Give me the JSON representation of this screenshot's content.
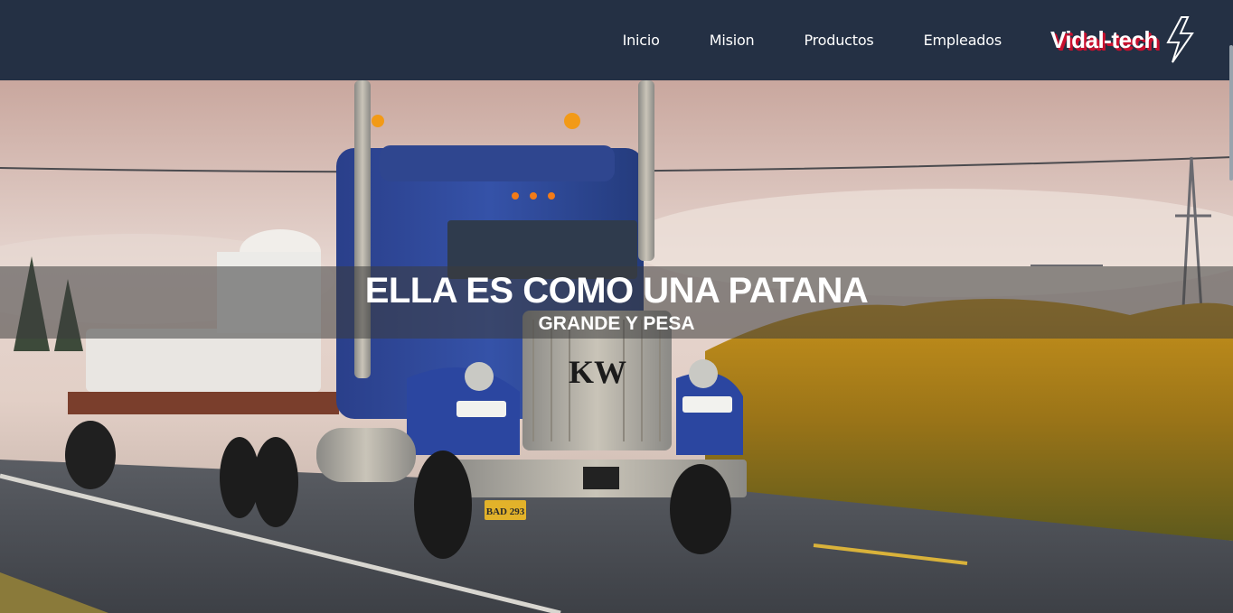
{
  "nav": {
    "links": [
      "Inicio",
      "Mision",
      "Productos",
      "Empleados"
    ],
    "brand": "Vidal-tech",
    "brand_icon": "lightning-bolt-icon"
  },
  "hero": {
    "image": "truck-on-highway-photo",
    "title": "ELLA ES COMO UNA PATANA",
    "subtitle": "GRANDE Y PESA",
    "truck_badge": "KW",
    "license_plate": "BAD 293"
  },
  "colors": {
    "navbar_bg": "#243044",
    "brand_shadow": "#c8102e",
    "text": "#ffffff"
  }
}
